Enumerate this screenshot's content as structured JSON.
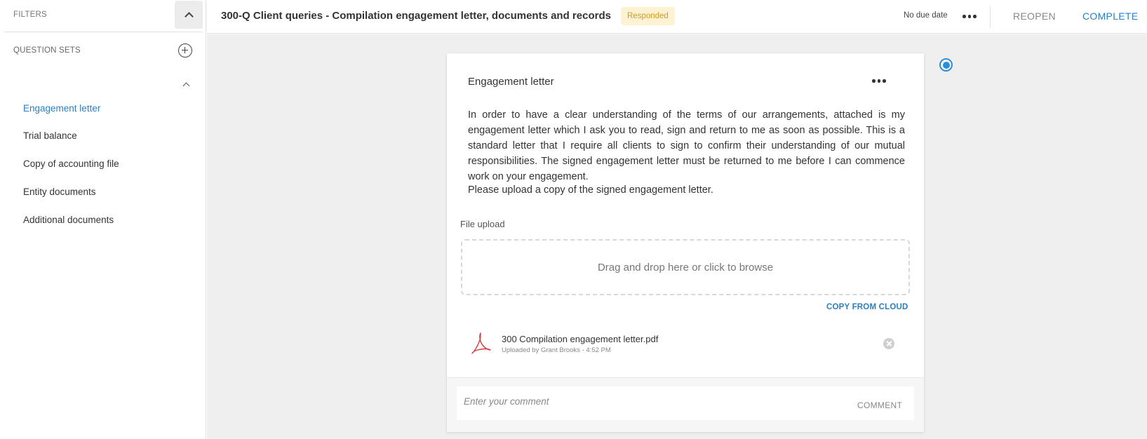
{
  "sidebar": {
    "filters_label": "FILTERS",
    "question_sets_label": "QUESTION SETS",
    "items": [
      {
        "label": "Engagement letter",
        "active": true
      },
      {
        "label": "Trial balance",
        "active": false
      },
      {
        "label": "Copy of accounting file",
        "active": false
      },
      {
        "label": "Entity documents",
        "active": false
      },
      {
        "label": "Additional documents",
        "active": false
      }
    ]
  },
  "header": {
    "title": "300-Q Client queries - Compilation engagement letter, documents and records",
    "status_badge": "Responded",
    "due_date": "No due date",
    "reopen_label": "REOPEN",
    "complete_label": "COMPLETE"
  },
  "card": {
    "title": "Engagement letter",
    "description": "In order to  have a clear understanding of the terms of our arrangements, attached is my engagement letter which I ask you to read, sign and return to me as soon as possible. This is a standard letter that I require all clients to sign to confirm their understanding of our mutual responsibilities. The signed engagement letter must be returned to me before I can commence work on your engagement.",
    "instruction": "Please upload a copy of the signed engagement letter.",
    "file_upload_label": "File upload",
    "dropzone_text": "Drag and drop here or click to browse",
    "copy_from_cloud": "COPY FROM CLOUD",
    "file": {
      "name": "300 Compilation engagement letter.pdf",
      "meta": "Uploaded by Grant Brooks - 4:52 PM",
      "icon": "pdf-icon"
    },
    "comment": {
      "placeholder": "Enter your comment",
      "value": "",
      "button_label": "COMMENT"
    }
  },
  "colors": {
    "accent": "#2a7fc4",
    "badge_bg": "#fdf3d3",
    "badge_text": "#d39a1a",
    "background": "#efefef"
  }
}
